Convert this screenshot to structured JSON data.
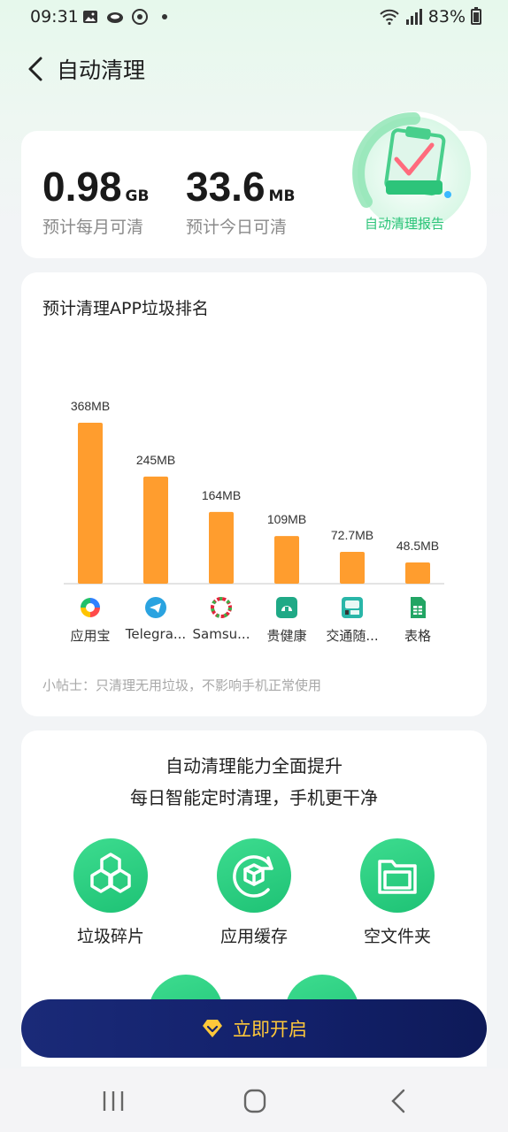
{
  "status_bar": {
    "time": "09:31",
    "battery": "83%",
    "icons": [
      "image-icon",
      "cloud-icon",
      "sync-icon",
      "dot-icon",
      "wifi-icon",
      "signal-icon",
      "battery-icon"
    ]
  },
  "header": {
    "title": "自动清理"
  },
  "summary": {
    "monthly": {
      "value": "0.98",
      "unit": "GB",
      "label": "预计每月可清"
    },
    "today": {
      "value": "33.6",
      "unit": "MB",
      "label": "预计今日可清"
    },
    "report_label": "自动清理报告"
  },
  "ranking": {
    "title": "预计清理APP垃圾排名",
    "tip": "小帖士：只清理无用垃圾，不影响手机正常使用"
  },
  "chart_data": {
    "type": "bar",
    "categories": [
      "应用宝",
      "Telegra...",
      "Samsu...",
      "贵健康",
      "交通随...",
      "表格"
    ],
    "values": [
      368,
      245,
      164,
      109,
      72.7,
      48.5
    ],
    "value_labels": [
      "368MB",
      "245MB",
      "164MB",
      "109MB",
      "72.7MB",
      "48.5MB"
    ],
    "unit": "MB",
    "ylim": [
      0,
      368
    ],
    "bar_color": "#ff9d2e",
    "icons": [
      "yingyongbao-icon",
      "telegram-icon",
      "samsung-global-goals-icon",
      "gui-health-icon",
      "traffic-pass-icon",
      "sheets-icon"
    ]
  },
  "features": {
    "title": "自动清理能力全面提升",
    "subtitle": "每日智能定时清理，手机更干净",
    "items": [
      {
        "label": "垃圾碎片",
        "icon": "hexagons-icon"
      },
      {
        "label": "应用缓存",
        "icon": "cube-refresh-icon"
      },
      {
        "label": "空文件夹",
        "icon": "folder-icon"
      }
    ]
  },
  "cta": {
    "label": "立即开启",
    "icon": "diamond-icon"
  },
  "colors": {
    "accent_green": "#2dc47a",
    "bar_orange": "#ff9d2e",
    "cta_navy": "#14216c",
    "cta_text": "#ffc83a"
  }
}
